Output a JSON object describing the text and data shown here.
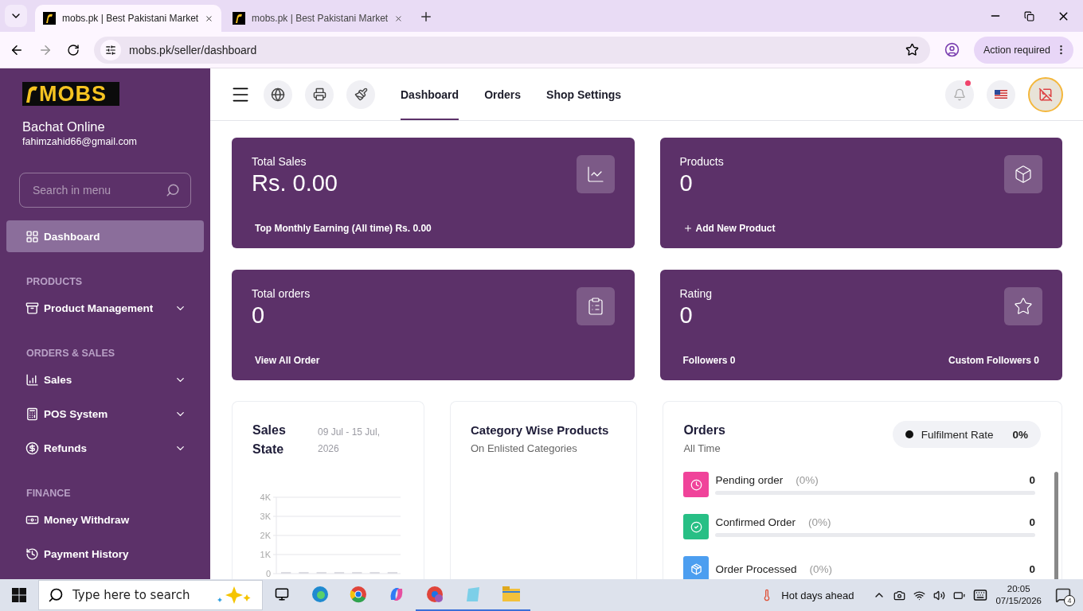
{
  "browser": {
    "tabs": [
      {
        "title": "mobs.pk | Best Pakistani Market",
        "selected": true
      },
      {
        "title": "mobs.pk | Best Pakistani Market",
        "selected": false
      }
    ],
    "url": "mobs.pk/seller/dashboard",
    "action_button": "Action required"
  },
  "sidebar": {
    "logo": "MOBS",
    "store_name": "Bachat Online",
    "email": "fahimzahid66@gmail.com",
    "search": {
      "placeholder": "Search in menu"
    },
    "sections": [
      {
        "items": [
          {
            "label": "Dashboard",
            "selected": true,
            "has_submenu": false
          }
        ]
      },
      {
        "heading": "PRODUCTS",
        "items": [
          {
            "label": "Product Management",
            "selected": false,
            "has_submenu": true
          }
        ]
      },
      {
        "heading": "ORDERS & SALES",
        "items": [
          {
            "label": "Sales",
            "selected": false,
            "has_submenu": true
          },
          {
            "label": "POS System",
            "selected": false,
            "has_submenu": true
          },
          {
            "label": "Refunds",
            "selected": false,
            "has_submenu": true
          }
        ]
      },
      {
        "heading": "FINANCE",
        "items": [
          {
            "label": "Money Withdraw",
            "selected": false,
            "has_submenu": false
          },
          {
            "label": "Payment History",
            "selected": false,
            "has_submenu": false
          }
        ]
      }
    ]
  },
  "topbar": {
    "tabs": [
      {
        "label": "Dashboard",
        "selected": true
      },
      {
        "label": "Orders",
        "selected": false
      },
      {
        "label": "Shop Settings",
        "selected": false
      }
    ],
    "has_notifications": true
  },
  "stat_cards": [
    {
      "title": "Total Sales",
      "value": "Rs. 0.00",
      "footer": [
        {
          "kind": "text",
          "text": "Top Monthly Earning (All time) Rs. 0.00"
        }
      ]
    },
    {
      "title": "Products",
      "value": "0",
      "footer": [
        {
          "kind": "add",
          "text": "Add New Product"
        }
      ]
    },
    {
      "title": "Total orders",
      "value": "0",
      "footer": [
        {
          "kind": "link",
          "text": "View All Order"
        }
      ]
    },
    {
      "title": "Rating",
      "value": "0",
      "footer": [
        {
          "kind": "text",
          "text": "Followers 0"
        },
        {
          "kind": "text",
          "text": "Custom Followers 0"
        }
      ]
    }
  ],
  "sales_state": {
    "title": "Sales State",
    "date_range": "09 Jul - 15 Jul, 2026",
    "chart_data": {
      "type": "bar",
      "grid": true,
      "values": [
        0,
        0,
        0,
        0,
        0,
        0,
        0
      ],
      "ylim": [
        0,
        4000
      ],
      "yticks": [
        {
          "value": 0,
          "label": "0"
        },
        {
          "value": 1000,
          "label": "1K"
        },
        {
          "value": 2000,
          "label": "2K"
        },
        {
          "value": 3000,
          "label": "3K"
        },
        {
          "value": 4000,
          "label": "4K"
        }
      ]
    }
  },
  "category_products": {
    "title": "Category Wise Products",
    "subtitle": "On Enlisted Categories"
  },
  "orders": {
    "title": "Orders",
    "subtitle": "All Time",
    "fulfilment": {
      "label": "Fulfilment Rate",
      "value": "0%"
    },
    "statuses": [
      {
        "label": "Pending order",
        "percent": "(0%)",
        "count": "0",
        "level": 0,
        "color": "#f0439a"
      },
      {
        "label": "Confirmed Order",
        "percent": "(0%)",
        "count": "0",
        "level": 0,
        "color": "#27bf85"
      },
      {
        "label": "Order Processed",
        "percent": "(0%)",
        "count": "0",
        "color": "#4c9ef0"
      }
    ]
  },
  "taskbar": {
    "search": {
      "placeholder": "Type here to search"
    },
    "weather": "Hot days ahead",
    "time": "20:05",
    "date": "07/15/2026",
    "notification_count": "4"
  }
}
